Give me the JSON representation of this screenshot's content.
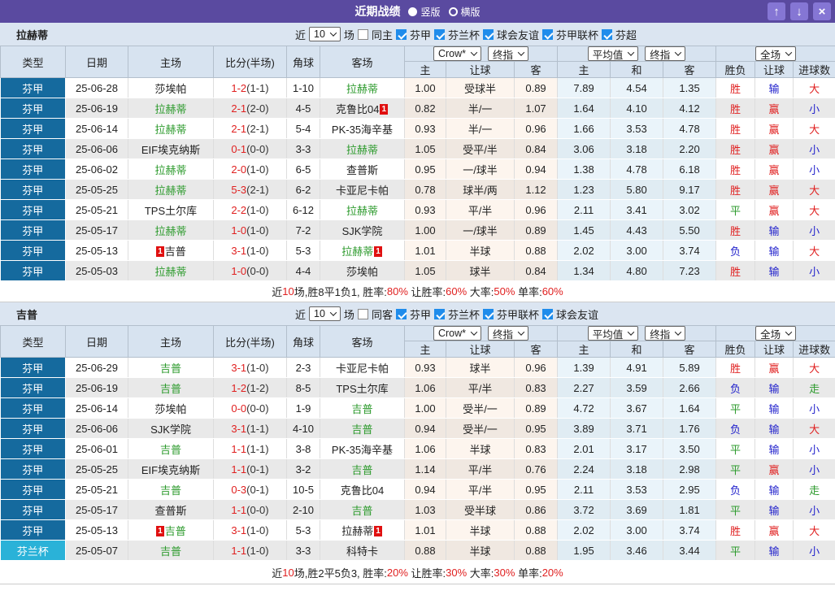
{
  "titlebar": {
    "title": "近期战绩",
    "radio_vertical": "竖版",
    "radio_horizontal": "横版",
    "up": "↑",
    "down": "↓",
    "close": "×"
  },
  "header": {
    "cols": [
      "类型",
      "日期",
      "主场",
      "比分(半场)",
      "角球",
      "客场"
    ],
    "odds_dropdowns": [
      "Crow*",
      "终指"
    ],
    "odds_cols": [
      "主",
      "让球",
      "客"
    ],
    "avg_dropdowns": [
      "平均值",
      "终指"
    ],
    "avg_cols": [
      "主",
      "和",
      "客"
    ],
    "result_dropdown": "全场",
    "result_cols": [
      "胜负",
      "让球",
      "进球数"
    ]
  },
  "sections": [
    {
      "team": "拉赫蒂",
      "filters": {
        "near": "近",
        "count": "10",
        "unit": "场",
        "same": {
          "label": "同主",
          "checked": false
        },
        "leagues": [
          {
            "label": "芬甲",
            "checked": true
          },
          {
            "label": "芬兰杯",
            "checked": true
          },
          {
            "label": "球会友谊",
            "checked": true
          },
          {
            "label": "芬甲联杯",
            "checked": true
          },
          {
            "label": "芬超",
            "checked": true
          }
        ]
      },
      "rows": [
        {
          "lg": "芬甲",
          "cup": false,
          "date": "25-06-28",
          "home": {
            "n": "莎埃帕"
          },
          "score": "1-2",
          "half": "(1-1)",
          "cor": "1-10",
          "away": {
            "n": "拉赫蒂",
            "self": true
          },
          "o": [
            "1.00",
            "受球半",
            "0.89"
          ],
          "a": [
            "7.89",
            "4.54",
            "1.35"
          ],
          "res": [
            [
              "胜",
              "red"
            ],
            [
              "输",
              "blue"
            ],
            [
              "大",
              "red"
            ]
          ]
        },
        {
          "lg": "芬甲",
          "cup": false,
          "date": "25-06-19",
          "home": {
            "n": "拉赫蒂",
            "self": true
          },
          "score": "2-1",
          "half": "(2-0)",
          "cor": "4-5",
          "away": {
            "n": "克鲁比04",
            "ba": "1"
          },
          "o": [
            "0.82",
            "半/一",
            "1.07"
          ],
          "a": [
            "1.64",
            "4.10",
            "4.12"
          ],
          "res": [
            [
              "胜",
              "red"
            ],
            [
              "赢",
              "red"
            ],
            [
              "小",
              "blue"
            ]
          ]
        },
        {
          "lg": "芬甲",
          "cup": false,
          "date": "25-06-14",
          "home": {
            "n": "拉赫蒂",
            "self": true
          },
          "score": "2-1",
          "half": "(2-1)",
          "cor": "5-4",
          "away": {
            "n": "PK-35海辛基"
          },
          "o": [
            "0.93",
            "半/一",
            "0.96"
          ],
          "a": [
            "1.66",
            "3.53",
            "4.78"
          ],
          "res": [
            [
              "胜",
              "red"
            ],
            [
              "赢",
              "red"
            ],
            [
              "大",
              "red"
            ]
          ]
        },
        {
          "lg": "芬甲",
          "cup": false,
          "date": "25-06-06",
          "home": {
            "n": "EIF埃克纳斯"
          },
          "score": "0-1",
          "half": "(0-0)",
          "cor": "3-3",
          "away": {
            "n": "拉赫蒂",
            "self": true
          },
          "o": [
            "1.05",
            "受平/半",
            "0.84"
          ],
          "a": [
            "3.06",
            "3.18",
            "2.20"
          ],
          "res": [
            [
              "胜",
              "red"
            ],
            [
              "赢",
              "red"
            ],
            [
              "小",
              "blue"
            ]
          ]
        },
        {
          "lg": "芬甲",
          "cup": false,
          "date": "25-06-02",
          "home": {
            "n": "拉赫蒂",
            "self": true
          },
          "score": "2-0",
          "half": "(1-0)",
          "cor": "6-5",
          "away": {
            "n": "查普斯"
          },
          "o": [
            "0.95",
            "一/球半",
            "0.94"
          ],
          "a": [
            "1.38",
            "4.78",
            "6.18"
          ],
          "res": [
            [
              "胜",
              "red"
            ],
            [
              "赢",
              "red"
            ],
            [
              "小",
              "blue"
            ]
          ]
        },
        {
          "lg": "芬甲",
          "cup": false,
          "date": "25-05-25",
          "home": {
            "n": "拉赫蒂",
            "self": true
          },
          "score": "5-3",
          "half": "(2-1)",
          "cor": "6-2",
          "away": {
            "n": "卡亚尼卡帕"
          },
          "o": [
            "0.78",
            "球半/两",
            "1.12"
          ],
          "a": [
            "1.23",
            "5.80",
            "9.17"
          ],
          "res": [
            [
              "胜",
              "red"
            ],
            [
              "赢",
              "red"
            ],
            [
              "大",
              "red"
            ]
          ]
        },
        {
          "lg": "芬甲",
          "cup": false,
          "date": "25-05-21",
          "home": {
            "n": "TPS土尔库"
          },
          "score": "2-2",
          "half": "(1-0)",
          "cor": "6-12",
          "away": {
            "n": "拉赫蒂",
            "self": true
          },
          "o": [
            "0.93",
            "平/半",
            "0.96"
          ],
          "a": [
            "2.11",
            "3.41",
            "3.02"
          ],
          "res": [
            [
              "平",
              "green"
            ],
            [
              "赢",
              "red"
            ],
            [
              "大",
              "red"
            ]
          ]
        },
        {
          "lg": "芬甲",
          "cup": false,
          "date": "25-05-17",
          "home": {
            "n": "拉赫蒂",
            "self": true
          },
          "score": "1-0",
          "half": "(1-0)",
          "cor": "7-2",
          "away": {
            "n": "SJK学院"
          },
          "o": [
            "1.00",
            "一/球半",
            "0.89"
          ],
          "a": [
            "1.45",
            "4.43",
            "5.50"
          ],
          "res": [
            [
              "胜",
              "red"
            ],
            [
              "输",
              "blue"
            ],
            [
              "小",
              "blue"
            ]
          ]
        },
        {
          "lg": "芬甲",
          "cup": false,
          "date": "25-05-13",
          "home": {
            "n": "吉普",
            "bp": "1"
          },
          "score": "3-1",
          "half": "(1-0)",
          "cor": "5-3",
          "away": {
            "n": "拉赫蒂",
            "self": true,
            "ba": "1"
          },
          "o": [
            "1.01",
            "半球",
            "0.88"
          ],
          "a": [
            "2.02",
            "3.00",
            "3.74"
          ],
          "res": [
            [
              "负",
              "blue"
            ],
            [
              "输",
              "blue"
            ],
            [
              "大",
              "red"
            ]
          ]
        },
        {
          "lg": "芬甲",
          "cup": false,
          "date": "25-05-03",
          "home": {
            "n": "拉赫蒂",
            "self": true
          },
          "score": "1-0",
          "half": "(0-0)",
          "cor": "4-4",
          "away": {
            "n": "莎埃帕"
          },
          "o": [
            "1.05",
            "球半",
            "0.84"
          ],
          "a": [
            "1.34",
            "4.80",
            "7.23"
          ],
          "res": [
            [
              "胜",
              "red"
            ],
            [
              "输",
              "blue"
            ],
            [
              "小",
              "blue"
            ]
          ]
        }
      ],
      "summary": [
        {
          "t": "近"
        },
        {
          "t": "10",
          "red": true
        },
        {
          "t": "场,胜8平1负1, 胜率:"
        },
        {
          "t": "80%",
          "red": true
        },
        {
          "t": " 让胜率:"
        },
        {
          "t": "60%",
          "red": true
        },
        {
          "t": " 大率:"
        },
        {
          "t": "50%",
          "red": true
        },
        {
          "t": " 单率:"
        },
        {
          "t": "60%",
          "red": true
        }
      ]
    },
    {
      "team": "吉普",
      "filters": {
        "near": "近",
        "count": "10",
        "unit": "场",
        "same": {
          "label": "同客",
          "checked": false
        },
        "leagues": [
          {
            "label": "芬甲",
            "checked": true
          },
          {
            "label": "芬兰杯",
            "checked": true
          },
          {
            "label": "芬甲联杯",
            "checked": true
          },
          {
            "label": "球会友谊",
            "checked": true
          }
        ]
      },
      "rows": [
        {
          "lg": "芬甲",
          "cup": false,
          "date": "25-06-29",
          "home": {
            "n": "吉普",
            "self": true
          },
          "score": "3-1",
          "half": "(1-0)",
          "cor": "2-3",
          "away": {
            "n": "卡亚尼卡帕"
          },
          "o": [
            "0.93",
            "球半",
            "0.96"
          ],
          "a": [
            "1.39",
            "4.91",
            "5.89"
          ],
          "res": [
            [
              "胜",
              "red"
            ],
            [
              "赢",
              "red"
            ],
            [
              "大",
              "red"
            ]
          ]
        },
        {
          "lg": "芬甲",
          "cup": false,
          "date": "25-06-19",
          "home": {
            "n": "吉普",
            "self": true
          },
          "score": "1-2",
          "half": "(1-2)",
          "cor": "8-5",
          "away": {
            "n": "TPS土尔库"
          },
          "o": [
            "1.06",
            "平/半",
            "0.83"
          ],
          "a": [
            "2.27",
            "3.59",
            "2.66"
          ],
          "res": [
            [
              "负",
              "blue"
            ],
            [
              "输",
              "blue"
            ],
            [
              "走",
              "green"
            ]
          ]
        },
        {
          "lg": "芬甲",
          "cup": false,
          "date": "25-06-14",
          "home": {
            "n": "莎埃帕"
          },
          "score": "0-0",
          "half": "(0-0)",
          "cor": "1-9",
          "away": {
            "n": "吉普",
            "self": true
          },
          "o": [
            "1.00",
            "受半/一",
            "0.89"
          ],
          "a": [
            "4.72",
            "3.67",
            "1.64"
          ],
          "res": [
            [
              "平",
              "green"
            ],
            [
              "输",
              "blue"
            ],
            [
              "小",
              "blue"
            ]
          ]
        },
        {
          "lg": "芬甲",
          "cup": false,
          "date": "25-06-06",
          "home": {
            "n": "SJK学院"
          },
          "score": "3-1",
          "half": "(1-1)",
          "cor": "4-10",
          "away": {
            "n": "吉普",
            "self": true
          },
          "o": [
            "0.94",
            "受半/一",
            "0.95"
          ],
          "a": [
            "3.89",
            "3.71",
            "1.76"
          ],
          "res": [
            [
              "负",
              "blue"
            ],
            [
              "输",
              "blue"
            ],
            [
              "大",
              "red"
            ]
          ]
        },
        {
          "lg": "芬甲",
          "cup": false,
          "date": "25-06-01",
          "home": {
            "n": "吉普",
            "self": true
          },
          "score": "1-1",
          "half": "(1-1)",
          "cor": "3-8",
          "away": {
            "n": "PK-35海辛基"
          },
          "o": [
            "1.06",
            "半球",
            "0.83"
          ],
          "a": [
            "2.01",
            "3.17",
            "3.50"
          ],
          "res": [
            [
              "平",
              "green"
            ],
            [
              "输",
              "blue"
            ],
            [
              "小",
              "blue"
            ]
          ]
        },
        {
          "lg": "芬甲",
          "cup": false,
          "date": "25-05-25",
          "home": {
            "n": "EIF埃克纳斯"
          },
          "score": "1-1",
          "half": "(0-1)",
          "cor": "3-2",
          "away": {
            "n": "吉普",
            "self": true
          },
          "o": [
            "1.14",
            "平/半",
            "0.76"
          ],
          "a": [
            "2.24",
            "3.18",
            "2.98"
          ],
          "res": [
            [
              "平",
              "green"
            ],
            [
              "赢",
              "red"
            ],
            [
              "小",
              "blue"
            ]
          ]
        },
        {
          "lg": "芬甲",
          "cup": false,
          "date": "25-05-21",
          "home": {
            "n": "吉普",
            "self": true
          },
          "score": "0-3",
          "half": "(0-1)",
          "cor": "10-5",
          "away": {
            "n": "克鲁比04"
          },
          "o": [
            "0.94",
            "平/半",
            "0.95"
          ],
          "a": [
            "2.11",
            "3.53",
            "2.95"
          ],
          "res": [
            [
              "负",
              "blue"
            ],
            [
              "输",
              "blue"
            ],
            [
              "走",
              "green"
            ]
          ]
        },
        {
          "lg": "芬甲",
          "cup": false,
          "date": "25-05-17",
          "home": {
            "n": "查普斯"
          },
          "score": "1-1",
          "half": "(0-0)",
          "cor": "2-10",
          "away": {
            "n": "吉普",
            "self": true
          },
          "o": [
            "1.03",
            "受半球",
            "0.86"
          ],
          "a": [
            "3.72",
            "3.69",
            "1.81"
          ],
          "res": [
            [
              "平",
              "green"
            ],
            [
              "输",
              "blue"
            ],
            [
              "小",
              "blue"
            ]
          ]
        },
        {
          "lg": "芬甲",
          "cup": false,
          "date": "25-05-13",
          "home": {
            "n": "吉普",
            "self": true,
            "bp": "1"
          },
          "score": "3-1",
          "half": "(1-0)",
          "cor": "5-3",
          "away": {
            "n": "拉赫蒂",
            "ba": "1"
          },
          "o": [
            "1.01",
            "半球",
            "0.88"
          ],
          "a": [
            "2.02",
            "3.00",
            "3.74"
          ],
          "res": [
            [
              "胜",
              "red"
            ],
            [
              "赢",
              "red"
            ],
            [
              "大",
              "red"
            ]
          ]
        },
        {
          "lg": "芬兰杯",
          "cup": true,
          "date": "25-05-07",
          "home": {
            "n": "吉普",
            "self": true
          },
          "score": "1-1",
          "half": "(1-0)",
          "cor": "3-3",
          "away": {
            "n": "科特卡"
          },
          "o": [
            "0.88",
            "半球",
            "0.88"
          ],
          "a": [
            "1.95",
            "3.46",
            "3.44"
          ],
          "res": [
            [
              "平",
              "green"
            ],
            [
              "输",
              "blue"
            ],
            [
              "小",
              "blue"
            ]
          ]
        }
      ],
      "summary": [
        {
          "t": "近"
        },
        {
          "t": "10",
          "red": true
        },
        {
          "t": "场,胜2平5负3, 胜率:"
        },
        {
          "t": "20%",
          "red": true
        },
        {
          "t": " 让胜率:"
        },
        {
          "t": "30%",
          "red": true
        },
        {
          "t": " 大率:"
        },
        {
          "t": "30%",
          "red": true
        },
        {
          "t": " 单率:"
        },
        {
          "t": "20%",
          "red": true
        }
      ]
    }
  ]
}
